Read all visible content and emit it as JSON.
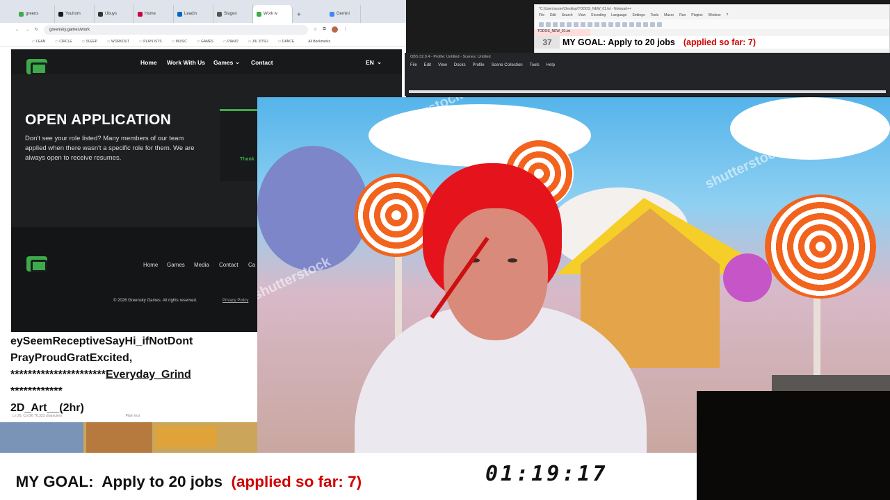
{
  "browser": {
    "tabs": [
      {
        "label": "greens",
        "color": "#3dab4a"
      },
      {
        "label": "Youhom",
        "color": "#1a1a1a"
      },
      {
        "label": "Ubuys",
        "color": "#333"
      },
      {
        "label": "Home",
        "color": "#c04"
      },
      {
        "label": "Leadin",
        "color": "#0a66c2"
      },
      {
        "label": "Slugen",
        "color": "#555"
      },
      {
        "label": "Work w",
        "color": "#3dab4a"
      },
      {
        "label": "Gemini",
        "color": "#4285f4"
      }
    ],
    "url": "greensky.games/work",
    "bookmarks": [
      "LEAN",
      "CIRCLE",
      "SLEEP",
      "WORKOUT",
      "PLAYLISTS",
      "MUSIC",
      "GAMES",
      "PIANO",
      "JIU JITSU",
      "DANCE"
    ],
    "all_bookmarks": "All Bookmarks"
  },
  "site": {
    "nav": [
      "Home",
      "Work With Us",
      "Games",
      "Contact"
    ],
    "lang": "EN",
    "hero_title": "OPEN APPLICATION",
    "hero_text": "Don't see your role listed? Many members of our team applied when there wasn't a specific role for them. We are always open to receive resumes.",
    "side_text": "Thank",
    "footer_nav": [
      "Home",
      "Games",
      "Media",
      "Contact",
      "Ca"
    ],
    "copyright": "© 2026 Greensky Games. All rights reserved.",
    "privacy": "Privacy Policy"
  },
  "notepad": {
    "line1": "eySeemReceptiveSayHi_ifNotDont",
    "line2": "PrayProudGratExcited,",
    "line3_stars": "**********************",
    "line3_text": "Everyday_Grind",
    "line4": "************",
    "line5": "2D_Art__(2hr)",
    "status_left": "Ln 26, Col 26   76,323 characters",
    "status_mid": "Plain text"
  },
  "npp": {
    "title": "*C:\\Users\\arsen\\Desktop\\TODOS_NEW_01.txt - Notepad++",
    "menu": [
      "File",
      "Edit",
      "Search",
      "View",
      "Encoding",
      "Language",
      "Settings",
      "Tools",
      "Macro",
      "Run",
      "Plugins",
      "Window",
      "?"
    ],
    "tab": "TODOS_NEW_01.txt",
    "line_number": "37",
    "line_text": "MY GOAL:  Apply to 20 jobs",
    "line_red": "(applied so far: 7)"
  },
  "obs": {
    "title": "OBS 32.0.4 - Profile: Untitled - Scenes: Untitled",
    "menu": [
      "File",
      "Edit",
      "View",
      "Docks",
      "Profile",
      "Scene Collection",
      "Tools",
      "Help"
    ]
  },
  "overlay": {
    "goal_text": "MY GOAL:  Apply to 20 jobs  ",
    "goal_red": "(applied so far: 7)",
    "timer": "01:19:17",
    "red_color": "#d10000"
  },
  "watermark": "shutterstock"
}
